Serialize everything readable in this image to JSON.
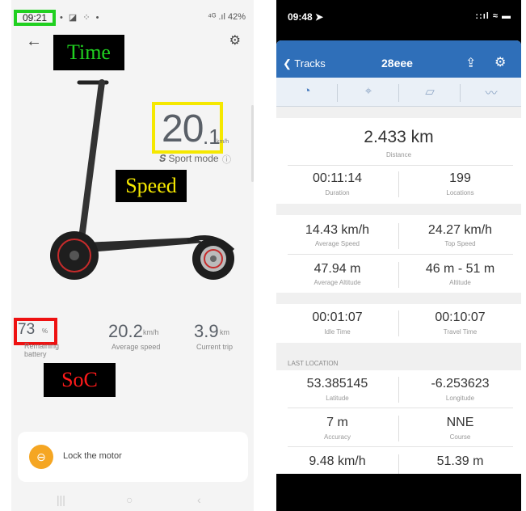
{
  "left_app": {
    "status": {
      "time": "09:21",
      "left_icons": "• ◪ ⁘ •",
      "right_text": "⁴ᴳ .ıl 42%"
    },
    "annotations": {
      "time": "Time",
      "speed": "Speed",
      "soc": "SoC"
    },
    "speed": {
      "integer": "20",
      "decimal": ".1",
      "unit": "km/h",
      "mode": "Sport mode"
    },
    "stats": {
      "battery": {
        "value": "73",
        "unit": "%",
        "label": "Remaining battery"
      },
      "average_speed": {
        "value": "20.2",
        "unit": "km/h",
        "label": "Average speed"
      },
      "current_trip": {
        "value": "3.9",
        "unit": "km",
        "label": "Current trip"
      }
    },
    "lock": {
      "label": "Lock the motor"
    },
    "accent_color": "#f5a623"
  },
  "right_app": {
    "status": {
      "time": "09:48 ➤",
      "icons": "::ıl ≈ ▬"
    },
    "navbar": {
      "back_label": "Tracks",
      "title": "28eee"
    },
    "distance": {
      "value": "2.433 km",
      "label": "Distance"
    },
    "rows": [
      {
        "left": {
          "value": "00:11:14",
          "label": "Duration"
        },
        "right": {
          "value": "199",
          "label": "Locations"
        }
      },
      {
        "left": {
          "value": "14.43 km/h",
          "label": "Average Speed"
        },
        "right": {
          "value": "24.27 km/h",
          "label": "Top Speed"
        }
      },
      {
        "left": {
          "value": "47.94 m",
          "label": "Average Altitude"
        },
        "right": {
          "value": "46 m - 51 m",
          "label": "Altitude"
        }
      },
      {
        "left": {
          "value": "00:01:07",
          "label": "Idle Time"
        },
        "right": {
          "value": "00:10:07",
          "label": "Travel Time"
        }
      }
    ],
    "last_location": {
      "header": "LAST LOCATION",
      "rows": [
        {
          "left": {
            "value": "53.385145",
            "label": "Latitude"
          },
          "right": {
            "value": "-6.253623",
            "label": "Longitude"
          }
        },
        {
          "left": {
            "value": "7 m",
            "label": "Accuracy"
          },
          "right": {
            "value": "NNE",
            "label": "Course"
          }
        },
        {
          "left": {
            "value": "9.48 km/h",
            "label": ""
          },
          "right": {
            "value": "51.39 m",
            "label": ""
          }
        }
      ]
    },
    "navbar_color": "#2f6fb9"
  }
}
